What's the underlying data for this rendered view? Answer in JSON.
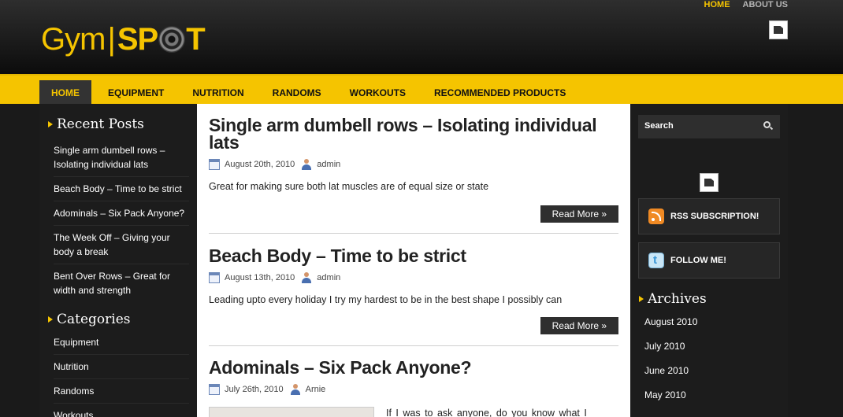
{
  "top_nav": {
    "home": "HOME",
    "about": "ABOUT US"
  },
  "logo": {
    "gym": "Gym",
    "separator": "|",
    "spot_prefix": "SP",
    "spot_suffix": "T"
  },
  "main_nav": [
    "HOME",
    "EQUIPMENT",
    "NUTRITION",
    "RANDOMS",
    "WORKOUTS",
    "RECOMMENDED PRODUCTS"
  ],
  "left_sidebar": {
    "recent_title": "Recent Posts",
    "recent_posts": [
      "Single arm dumbell rows – Isolating individual lats",
      "Beach Body – Time to be strict",
      "Adominals – Six Pack Anyone?",
      "The Week Off – Giving your body a break",
      "Bent Over Rows – Great for width and strength"
    ],
    "categories_title": "Categories",
    "categories": [
      "Equipment",
      "Nutrition",
      "Randoms",
      "Workouts"
    ]
  },
  "posts": [
    {
      "title": "Single arm dumbell rows – Isolating individual lats",
      "date": "August 20th, 2010",
      "author": "admin",
      "excerpt": "Great for making sure both lat muscles are of equal size or state",
      "read_more": "Read More »"
    },
    {
      "title": "Beach Body – Time to be strict",
      "date": "August 13th, 2010",
      "author": "admin",
      "excerpt": "Leading upto every holiday I try my hardest to be in the best shape I possibly can",
      "read_more": "Read More »"
    },
    {
      "title": "Adominals – Six Pack Anyone?",
      "date": "July 26th, 2010",
      "author": "Arnie",
      "excerpt": "If I was to ask anyone, do you know what I"
    }
  ],
  "right_sidebar": {
    "search_placeholder": "Search",
    "rss_label": "RSS SUBSCRIPTION!",
    "follow_label": "FOLLOW ME!",
    "archives_title": "Archives",
    "archives": [
      "August 2010",
      "July 2010",
      "June 2010",
      "May 2010"
    ]
  },
  "colors": {
    "accent": "#f5c400",
    "dark": "#1c1c1c",
    "nav_active_bg": "#333333"
  },
  "icons": [
    "search-icon",
    "rss-icon",
    "twitter-icon",
    "calendar-icon",
    "user-icon",
    "broken-image-icon"
  ]
}
